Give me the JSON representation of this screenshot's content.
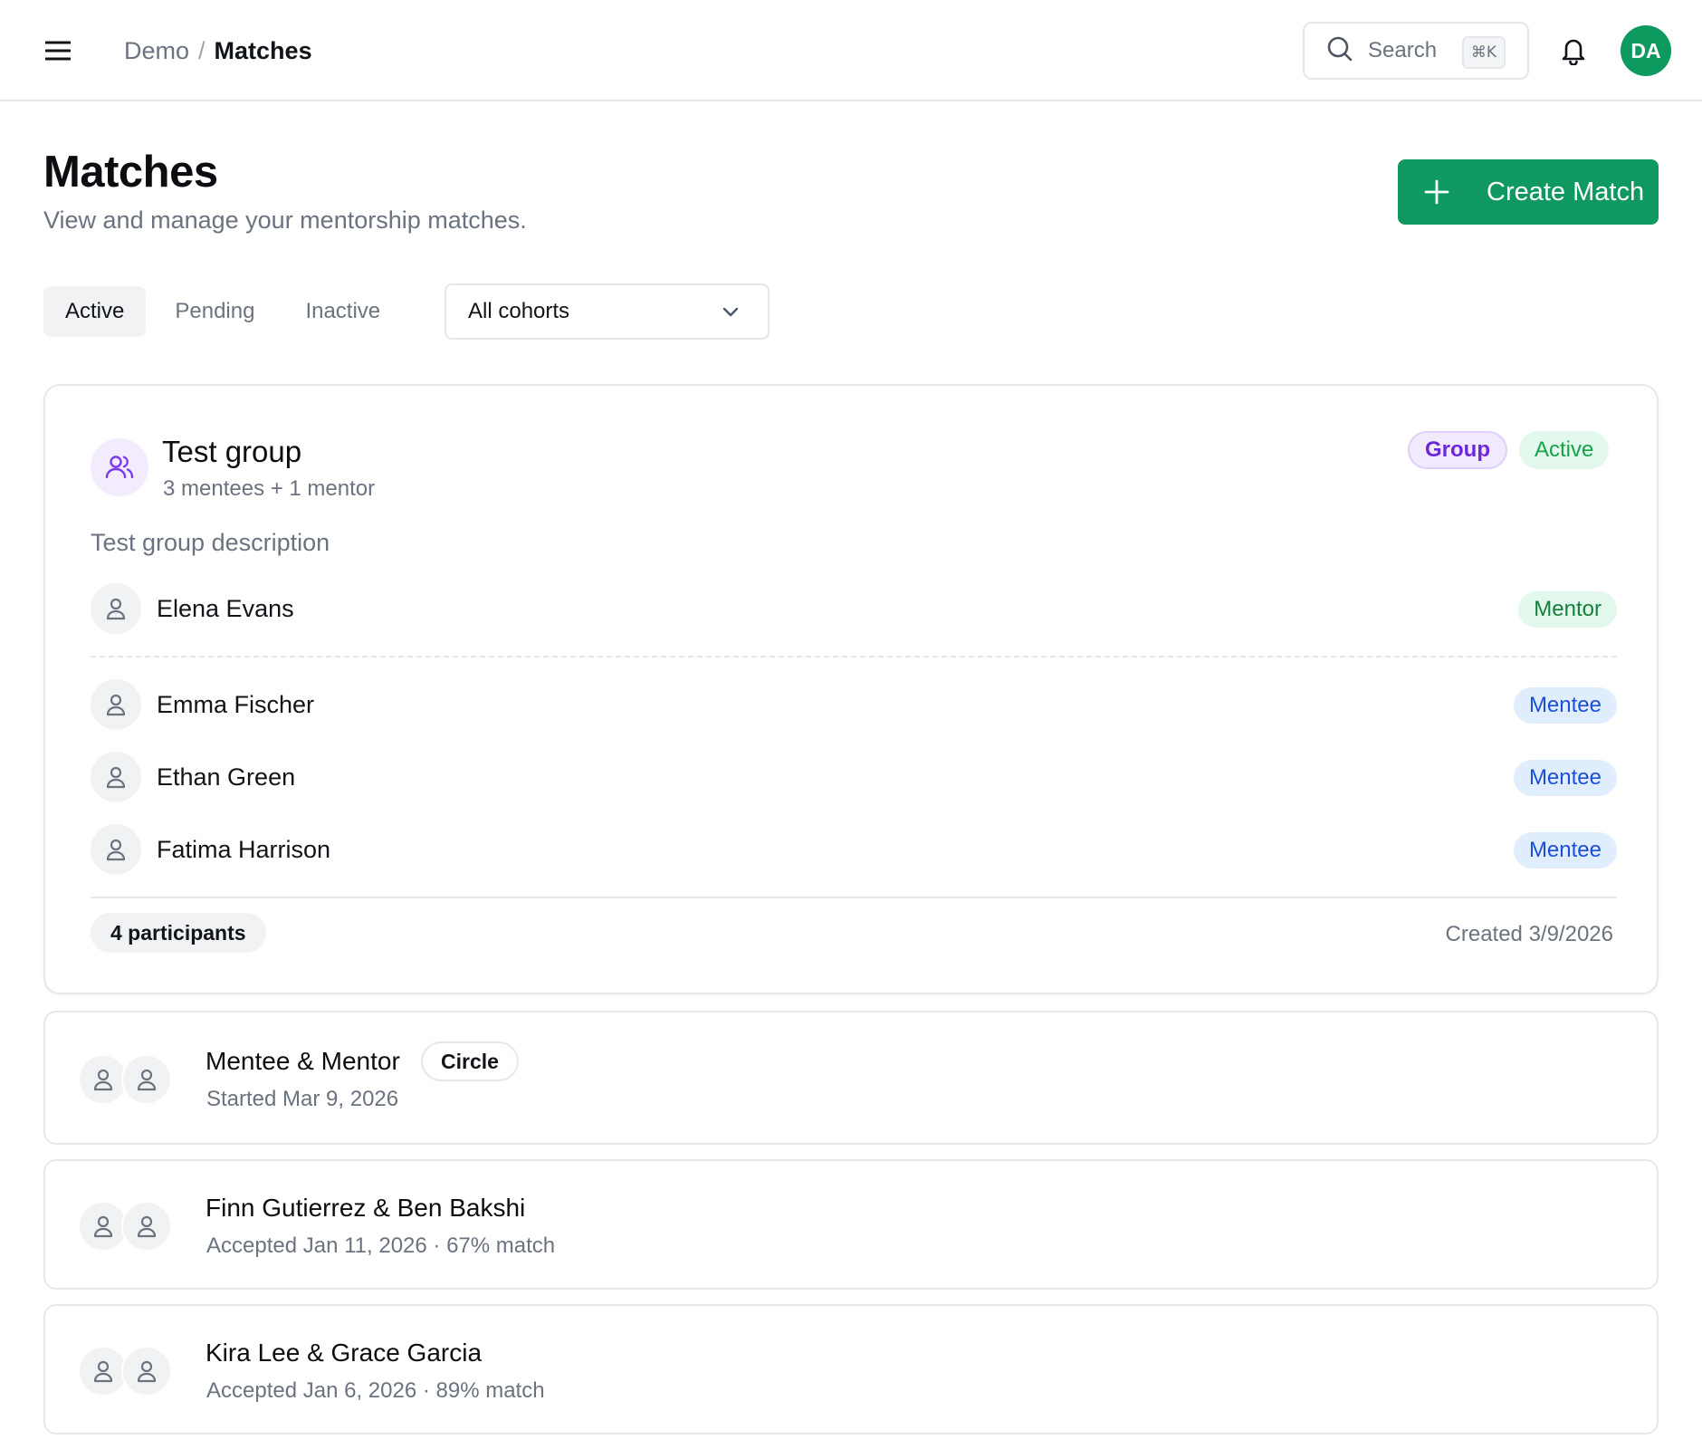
{
  "topbar": {
    "breadcrumb_root": "Demo",
    "breadcrumb_sep": "/",
    "breadcrumb_current": "Matches",
    "search_label": "Search",
    "search_shortcut": "⌘K",
    "user_initials": "DA",
    "avatar_color": "#0e9a5f"
  },
  "header": {
    "title": "Matches",
    "subtitle": "View and manage your mentorship matches.",
    "create_label": "Create Match",
    "accent_color": "#0f9960"
  },
  "tabs": [
    {
      "label": "Active",
      "selected": true
    },
    {
      "label": "Pending",
      "selected": false
    },
    {
      "label": "Inactive",
      "selected": false
    }
  ],
  "cohort_filter": {
    "value": "All cohorts"
  },
  "group": {
    "title": "Test group",
    "subtitle": "3 mentees + 1 mentor",
    "badge_type": "Group",
    "badge_status": "Active",
    "description": "Test group description",
    "mentor": {
      "name": "Elena Evans",
      "role": "Mentor"
    },
    "mentees": [
      {
        "name": "Emma Fischer",
        "role": "Mentee"
      },
      {
        "name": "Ethan Green",
        "role": "Mentee"
      },
      {
        "name": "Fatima Harrison",
        "role": "Mentee"
      }
    ],
    "participants": "4 participants",
    "created": "Created 3/9/2026"
  },
  "matches": [
    {
      "title": "Mentee & Mentor",
      "badge": "Circle",
      "subtitle": "Started Mar 9, 2026"
    },
    {
      "title": "Finn Gutierrez & Ben Bakshi",
      "subtitle": "Accepted Jan 11, 2026 · 67% match"
    },
    {
      "title": "Kira Lee & Grace Garcia",
      "subtitle": "Accepted Jan 6, 2026 · 89% match"
    }
  ]
}
